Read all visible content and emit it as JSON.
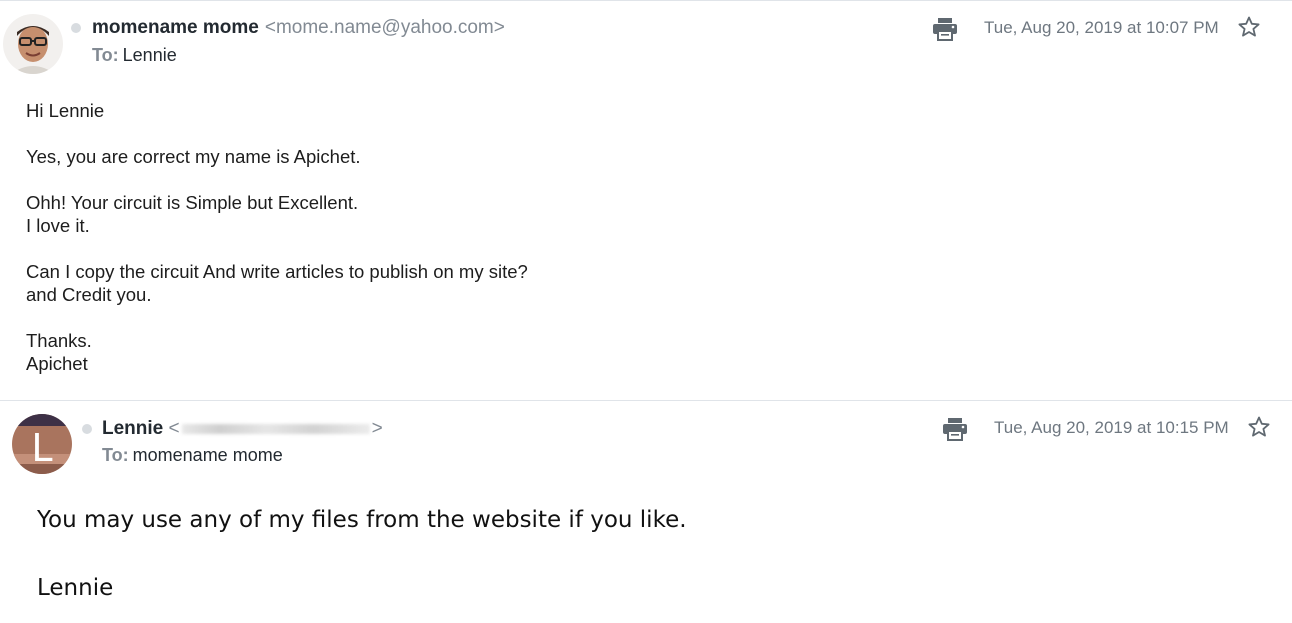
{
  "messages": [
    {
      "sender_name": "momename mome",
      "sender_email": "<mome.name@yahoo.com>",
      "to_label": "To:",
      "to_value": "Lennie",
      "timestamp": "Tue, Aug 20, 2019 at 10:07 PM",
      "body": [
        [
          "Hi Lennie"
        ],
        [
          "Yes, you are correct my name is Apichet."
        ],
        [
          "Ohh!  Your circuit is Simple but Excellent.",
          "I love it."
        ],
        [
          "Can I copy the circuit  And write articles to publish on my site?",
          "and Credit you."
        ],
        [
          "Thanks.",
          "Apichet"
        ]
      ]
    },
    {
      "sender_name": "Lennie",
      "sender_email_open": "<",
      "sender_email_close": ">",
      "avatar_letter": "L",
      "to_label": "To:",
      "to_value": "momename mome",
      "timestamp": "Tue, Aug 20, 2019 at 10:15 PM",
      "body": [
        "You may use any of my files from the website if you like.",
        "Lennie"
      ]
    }
  ],
  "icons": {
    "print": "print-icon",
    "star": "star-outline-icon",
    "status": "status-dot-icon"
  },
  "colors": {
    "divider": "#e0e4e9",
    "muted_text": "#828a93",
    "icon": "#6e7780"
  }
}
